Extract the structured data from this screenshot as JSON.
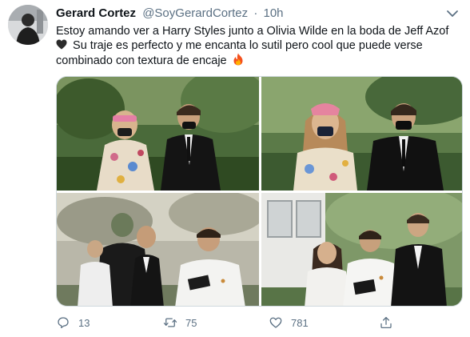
{
  "tweet": {
    "author_name": "Gerard Cortez",
    "author_handle": "@SoyGerardCortez",
    "separator": "·",
    "time": "10h",
    "text_part1": "Estoy amando ver a Harry Styles junto a Olivia Wilde en la boda de Jeff Azof",
    "text_part2": "Su traje es perfecto y me encanta lo sutil pero cool que puede verse combinado con textura de encaje",
    "emoji_1": "black-heart",
    "emoji_2": "fire"
  },
  "actions": {
    "reply_count": "13",
    "retweet_count": "75",
    "like_count": "781"
  },
  "icons": {
    "reply": "reply-icon",
    "retweet": "retweet-icon",
    "like": "heart-icon",
    "share": "share-icon",
    "more": "chevron-down-icon"
  },
  "colors": {
    "text_primary": "#0f1419",
    "text_secondary": "#5b7083",
    "border": "#cfd9de"
  }
}
